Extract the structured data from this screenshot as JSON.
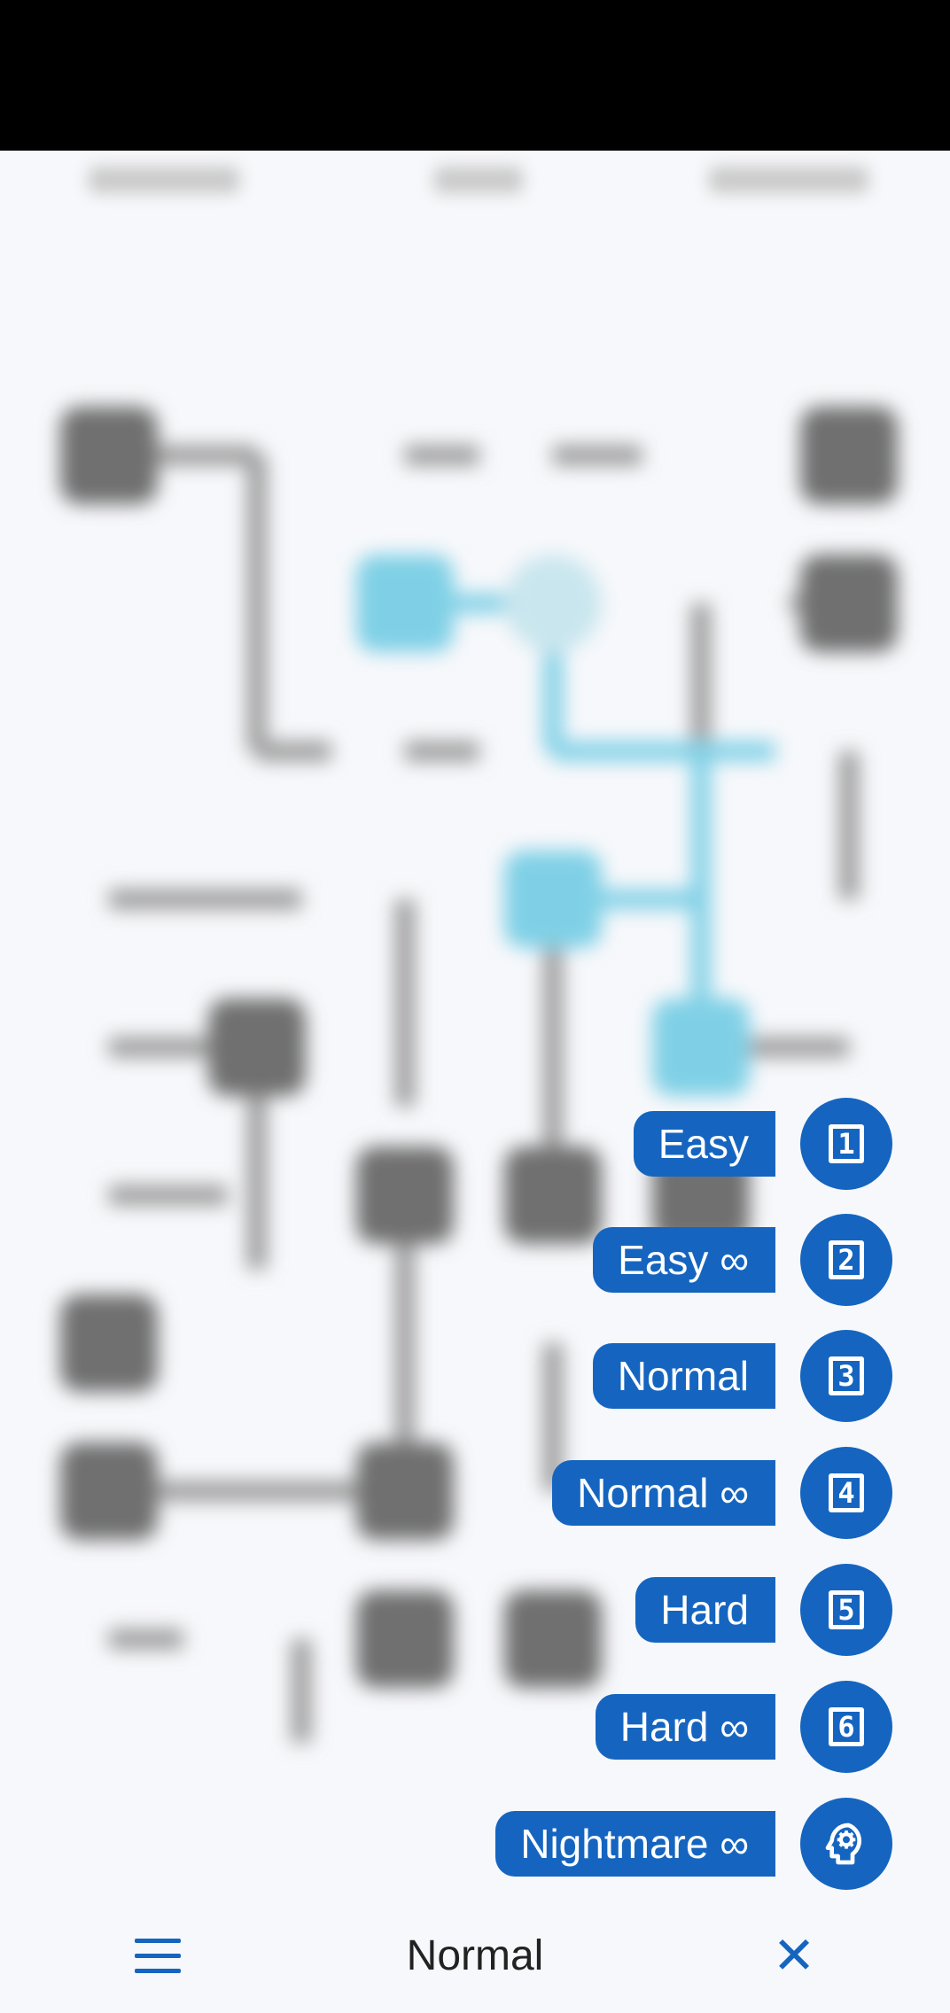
{
  "menu": {
    "items": [
      {
        "label": "Easy",
        "icon": "1"
      },
      {
        "label": "Easy ∞",
        "icon": "2"
      },
      {
        "label": "Normal",
        "icon": "3"
      },
      {
        "label": "Normal ∞",
        "icon": "4"
      },
      {
        "label": "Hard",
        "icon": "5"
      },
      {
        "label": "Hard ∞",
        "icon": "6"
      },
      {
        "label": "Nightmare ∞",
        "icon": "head-gear-icon"
      }
    ]
  },
  "bottom_bar": {
    "title": "Normal",
    "menu_icon": "hamburger-icon",
    "close_icon": "close-icon"
  },
  "colors": {
    "accent": "#1565c0",
    "pipe_active": "#7fd0e6",
    "pipe_idle": "#8a8a8a"
  }
}
